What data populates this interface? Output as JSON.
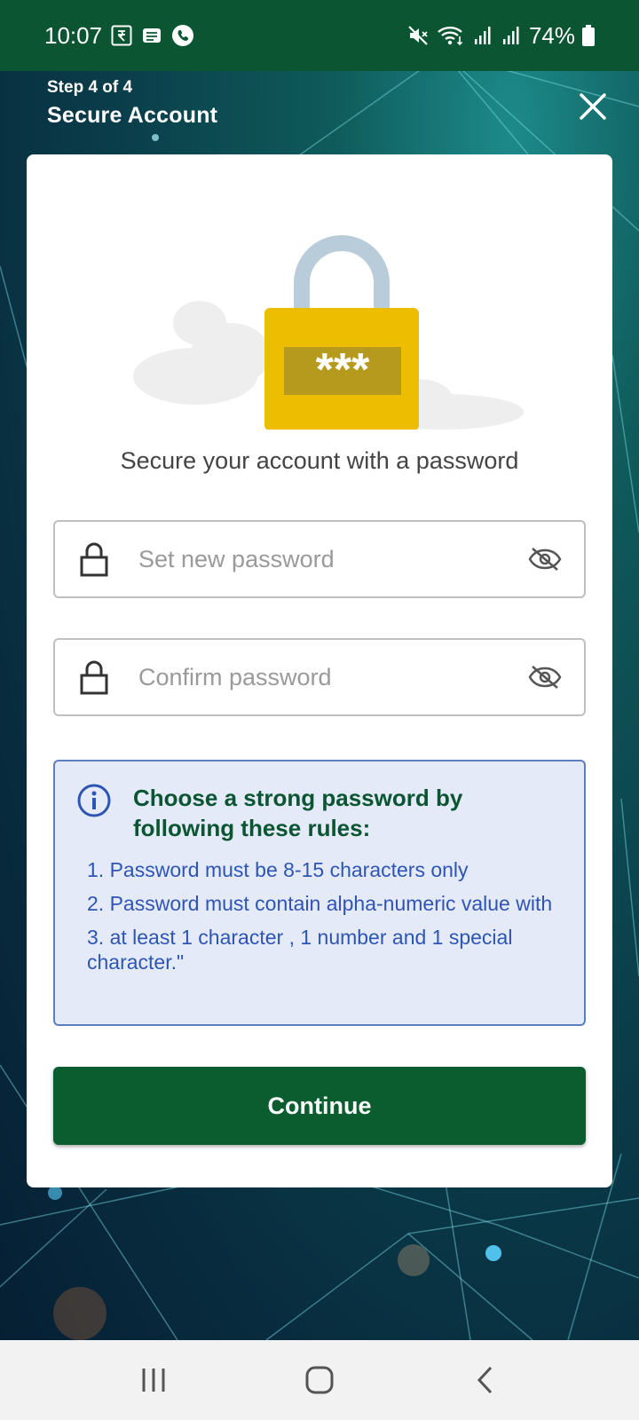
{
  "status_bar": {
    "time": "10:07",
    "battery": "74%"
  },
  "header": {
    "step": "Step 4 of 4",
    "title": "Secure Account"
  },
  "card": {
    "subtitle": "Secure your account with a password",
    "illustration_text": "***",
    "new_password": {
      "value": "",
      "placeholder": "Set new password"
    },
    "confirm_password": {
      "value": "",
      "placeholder": "Confirm password"
    },
    "info": {
      "heading": "Choose a strong password by following these rules:",
      "rules": [
        "1. Password must be 8-15 characters only",
        "2.  Password must contain alpha-numeric value with",
        "3.  at least 1 character , 1 number and 1 special character.\""
      ]
    },
    "continue_label": "Continue"
  },
  "colors": {
    "brand_green": "#0b5c2e",
    "status_bar": "#0b5532",
    "info_bg": "#e4eaf8",
    "info_border": "#5c7fc1",
    "info_text": "#2f55b4",
    "lock_yellow": "#ecbd00"
  },
  "icons": {
    "status_left": [
      "rupee-icon",
      "message-icon",
      "phone-icon"
    ],
    "status_right": [
      "mute-icon",
      "wifi-icon",
      "signal-icon",
      "signal-icon",
      "battery-icon"
    ],
    "nav": [
      "recent-apps-icon",
      "home-icon",
      "back-icon"
    ]
  }
}
